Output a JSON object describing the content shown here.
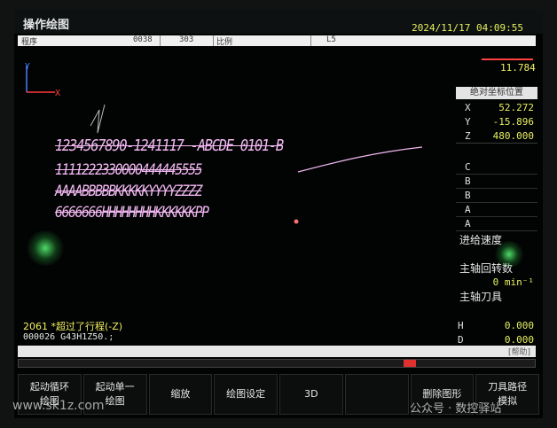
{
  "window": {
    "title": "操作绘图",
    "datetime": "2024/11/17 04:09:55"
  },
  "statusbar": {
    "mode": "程序",
    "line": "0038",
    "seq": "303",
    "state": "比例",
    "axis": "L5"
  },
  "plot": {
    "axis_y_label": "Y",
    "axis_x_label": "X",
    "scale_value": "11.784",
    "trace_color": "#f2b8f2",
    "engraving_lines": [
      "1234567890-1241117 -ABCDE 0101-B",
      "1111222330000444445555",
      "AAAABBBBBKKKKKYYYYZZZZ",
      "6666666HHHHHHHHKKKKKKPP"
    ]
  },
  "coord_panel": {
    "header": "绝对坐标位置",
    "coords": [
      {
        "axis": "X",
        "value": "52.272"
      },
      {
        "axis": "Y",
        "value": "-15.896"
      },
      {
        "axis": "Z",
        "value": "480.000"
      }
    ],
    "letters": [
      "C",
      "B",
      "B",
      "A",
      "A"
    ],
    "feed_label": "进给速度",
    "spindle_label": "主轴回转数",
    "spindle_value": "0 min⁻¹",
    "tool_label": "主轴刀具",
    "h_label": "H",
    "h_value": "0.000",
    "d_label": "D",
    "d_value": "0.000"
  },
  "alarm": {
    "text": "2061   *超过了行程(-Z)"
  },
  "command": {
    "text": "000026 G43H1Z50.;"
  },
  "help": {
    "label": "[帮助]"
  },
  "softkeys": [
    "起动循环\n绘图",
    "起动单一\n绘图",
    "缩放",
    "绘图设定",
    "3D",
    "",
    "删除图形",
    "刀具路径\n模拟"
  ],
  "watermark": {
    "left": "www.sk1z.com",
    "right": "公众号 · 数控驿站"
  },
  "colors": {
    "value_yellow": "#e8f060",
    "alarm_yellow": "#f0f060",
    "trace_pink": "#f2b8f2",
    "axis_blue": "#4a7cff",
    "axis_red": "#ff3b3b"
  }
}
